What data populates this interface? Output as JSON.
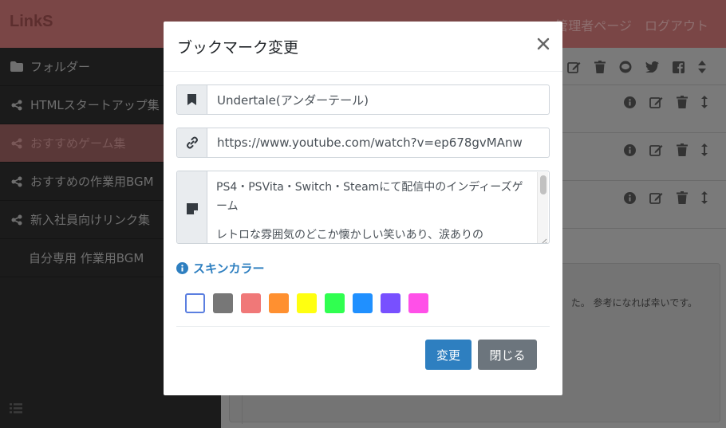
{
  "app": {
    "logo": "LinkS"
  },
  "topnav": {
    "admin": "管理者ページ",
    "logout": "ログアウト"
  },
  "sidebar": {
    "items": [
      {
        "label": "フォルダー",
        "icon": "folder-icon"
      },
      {
        "label": "HTMLスタートアップ集",
        "icon": "share-icon"
      },
      {
        "label": "おすすめゲーム集",
        "icon": "share-icon",
        "active": true
      },
      {
        "label": "おすすめの作業用BGM",
        "icon": "share-icon"
      },
      {
        "label": "新入社員向けリンク集",
        "icon": "share-icon"
      },
      {
        "label": "自分専用 作業用BGM",
        "icon": ""
      }
    ],
    "bottom_icon": "list-icon"
  },
  "main": {
    "description_fragment": "た。 参考になれば幸いです。"
  },
  "modal": {
    "title": "ブックマーク変更",
    "title_field": {
      "value": "Undertale(アンダーテール)",
      "icon": "bookmark-icon"
    },
    "url_field": {
      "value": "https://www.youtube.com/watch?v=ep678gvMAnw",
      "icon": "link-icon"
    },
    "note_field": {
      "value": "PS4・PSVita・Switch・Steamにて配信中のインディーズゲーム\n\nレトロな雰囲気のどこか懐かしい笑いあり、涙ありの",
      "icon": "sticky-note-icon"
    },
    "skin_label": "スキンカラー",
    "skin_colors": [
      "#ffffff",
      "#777777",
      "#f07878",
      "#ff9030",
      "#ffff10",
      "#30ff50",
      "#2090ff",
      "#7850ff",
      "#ff50e8"
    ],
    "selected_color_index": 0,
    "buttons": {
      "submit": "変更",
      "close": "閉じる"
    }
  },
  "colors": {
    "primary": "#2e7fc0",
    "secondary": "#6c757d",
    "accent_header": "#7a4646"
  }
}
